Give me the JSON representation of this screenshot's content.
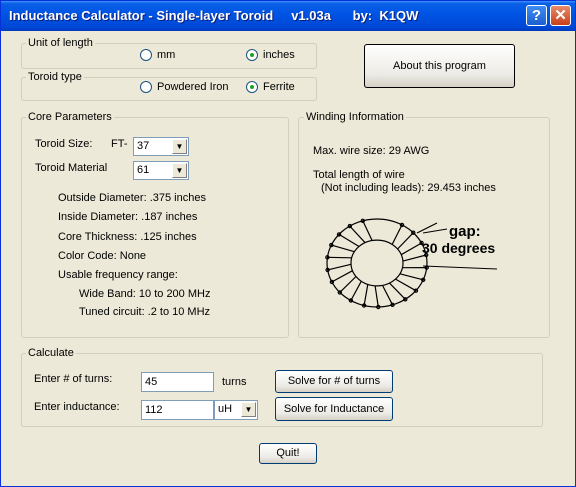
{
  "window": {
    "title": "Inductance Calculator - Single-layer Toroid     v1.03a      by:  K1QW",
    "help_glyph": "?",
    "close_glyph": "✕"
  },
  "unit_of_length": {
    "legend": "Unit of length",
    "options": [
      {
        "label": "mm",
        "selected": false
      },
      {
        "label": "inches",
        "selected": true
      }
    ]
  },
  "toroid_type": {
    "legend": "Toroid type",
    "options": [
      {
        "label": "Powdered Iron",
        "selected": false
      },
      {
        "label": "Ferrite",
        "selected": true
      }
    ]
  },
  "about_button": "About this program",
  "core": {
    "legend": "Core Parameters",
    "size_label": "Toroid Size:",
    "size_prefix": "FT-",
    "size_value": "37",
    "material_label": "Toroid Material",
    "material_value": "61",
    "od": "Outside Diameter:  .375 inches",
    "id": "Inside Diameter:  .187 inches",
    "thickness": "Core Thickness:  .125 inches",
    "color_code": "Color Code:      None",
    "freq_header": "Usable frequency range:",
    "wide_band": "Wide Band:  10  to  200  MHz",
    "tuned": "Tuned circuit:  .2  to  10 MHz"
  },
  "winding": {
    "legend": "Winding Information",
    "max_wire": "Max. wire size:  29  AWG",
    "total_len": "Total length of wire",
    "not_incl": "(Not including leads):   29.453  inches",
    "gap_label": "gap:",
    "gap_value": "30 degrees"
  },
  "calculate": {
    "legend": "Calculate",
    "turns_label": "Enter # of turns:",
    "turns_value": "45",
    "turns_unit": "turns",
    "solve_turns": "Solve for # of turns",
    "ind_label": "Enter inductance:",
    "ind_value": "112",
    "ind_unit": "uH",
    "solve_ind": "Solve for Inductance"
  },
  "quit_button": "Quit!"
}
